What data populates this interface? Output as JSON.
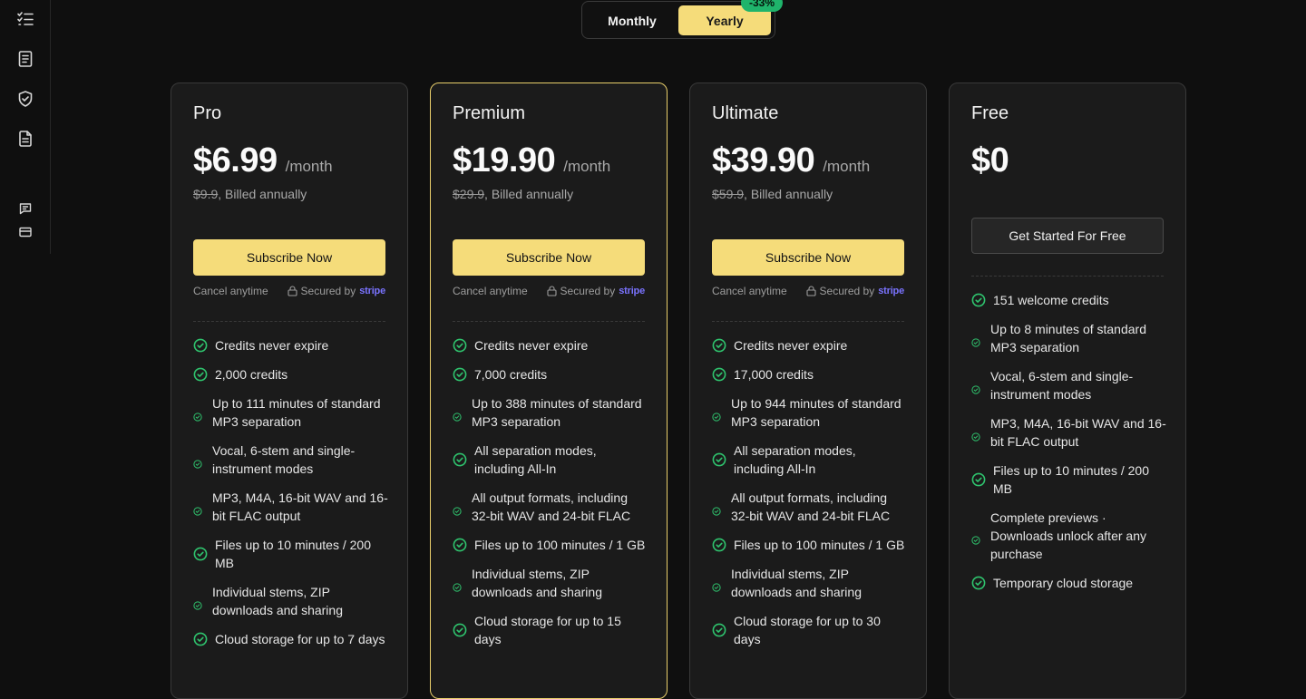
{
  "sidebar": {
    "icons": [
      "checklist-icon",
      "document-icon",
      "shield-check-icon",
      "file-text-icon",
      "chat-icon",
      "credit-card-icon"
    ]
  },
  "billing_toggle": {
    "monthly_label": "Monthly",
    "yearly_label": "Yearly",
    "discount_badge": "-33%",
    "selected": "Yearly"
  },
  "colors": {
    "accent_yellow": "#f5dc7a",
    "badge_green": "#1fb46b",
    "check_green": "#2fc46e",
    "stripe_purple": "#7a73ff",
    "card_bg": "#1b1b1b",
    "page_bg": "#0f0f0f"
  },
  "plans": [
    {
      "name": "Pro",
      "price": "$6.99",
      "period": "/month",
      "original_price": "$9.9",
      "billed_text": ", Billed annually",
      "cta": "Subscribe Now",
      "cancel_text": "Cancel anytime",
      "secured_text": "Secured by",
      "secured_brand": "stripe",
      "features": [
        "Credits never expire",
        "2,000 credits",
        "Up to 111 minutes of standard MP3 separation",
        "Vocal, 6-stem and single-instrument modes",
        "MP3, M4A, 16-bit WAV and 16-bit FLAC output",
        "Files up to 10 minutes / 200 MB",
        "Individual stems, ZIP downloads and sharing",
        "Cloud storage for up to 7 days"
      ]
    },
    {
      "name": "Premium",
      "price": "$19.90",
      "period": "/month",
      "original_price": "$29.9",
      "billed_text": ", Billed annually",
      "cta": "Subscribe Now",
      "cancel_text": "Cancel anytime",
      "secured_text": "Secured by",
      "secured_brand": "stripe",
      "features": [
        "Credits never expire",
        "7,000 credits",
        "Up to 388 minutes of standard MP3 separation",
        "All separation modes, including All-In",
        "All output formats, including 32-bit WAV and 24-bit FLAC",
        "Files up to 100 minutes / 1 GB",
        "Individual stems, ZIP downloads and sharing",
        "Cloud storage for up to 15 days"
      ]
    },
    {
      "name": "Ultimate",
      "price": "$39.90",
      "period": "/month",
      "original_price": "$59.9",
      "billed_text": ", Billed annually",
      "cta": "Subscribe Now",
      "cancel_text": "Cancel anytime",
      "secured_text": "Secured by",
      "secured_brand": "stripe",
      "features": [
        "Credits never expire",
        "17,000 credits",
        "Up to 944 minutes of standard MP3 separation",
        "All separation modes, including All-In",
        "All output formats, including 32-bit WAV and 24-bit FLAC",
        "Files up to 100 minutes / 1 GB",
        "Individual stems, ZIP downloads and sharing",
        "Cloud storage for up to 30 days"
      ]
    },
    {
      "name": "Free",
      "price": "$0",
      "cta": "Get Started For Free",
      "features": [
        "151 welcome credits",
        "Up to 8 minutes of standard MP3 separation",
        "Vocal, 6-stem and single-instrument modes",
        "MP3, M4A, 16-bit WAV and 16-bit FLAC output",
        "Files up to 10 minutes / 200 MB",
        "Complete previews · Downloads unlock after any purchase",
        "Temporary cloud storage"
      ]
    }
  ]
}
